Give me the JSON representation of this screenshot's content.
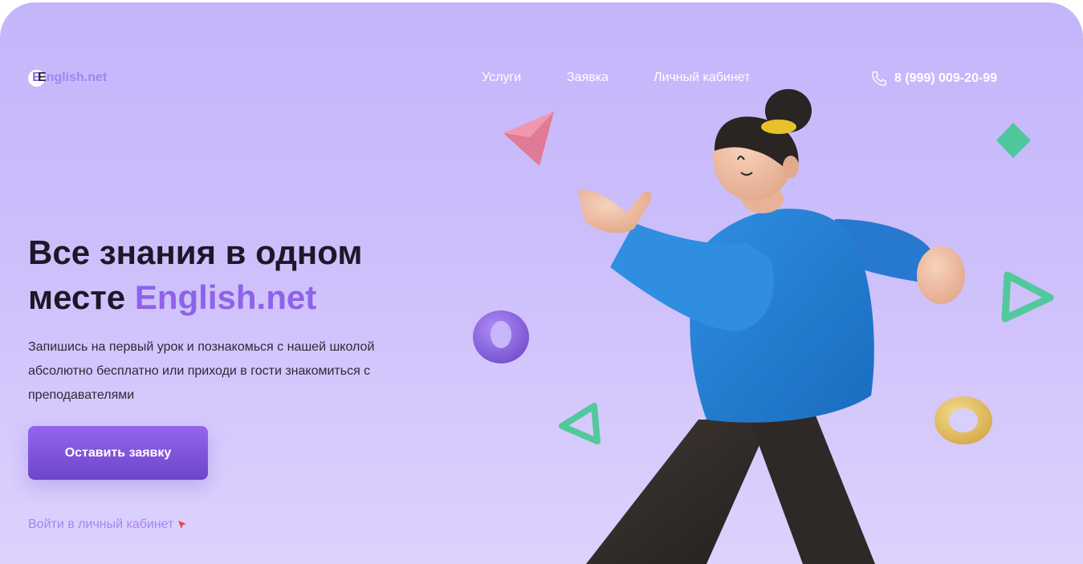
{
  "header": {
    "logo": {
      "mark": "E",
      "first_letter": "E",
      "rest": "nglish.net"
    },
    "nav": [
      "Услуги",
      "Заявка",
      "Личный кабинет"
    ],
    "phone": "8 (999) 009-20-99"
  },
  "hero": {
    "title_line1": "Все знания в одном",
    "title_line2_prefix": "месте ",
    "title_accent": "English.net",
    "subtitle": "Запишись на первый урок и познакомься с нашей школой абсолютно бесплатно или приходи в гости знакомиться с преподавателями",
    "cta_label": "Оставить заявку",
    "login_link": "Войти в личный кабинет"
  },
  "colors": {
    "accent": "#8e62ea",
    "background": "#c4b5fb",
    "heading": "#1c1828",
    "button": "#7a52d8"
  },
  "icons": {
    "phone": "phone-icon",
    "cursor": "cursor-arrow-icon"
  },
  "illustration": "3d-character-walking"
}
